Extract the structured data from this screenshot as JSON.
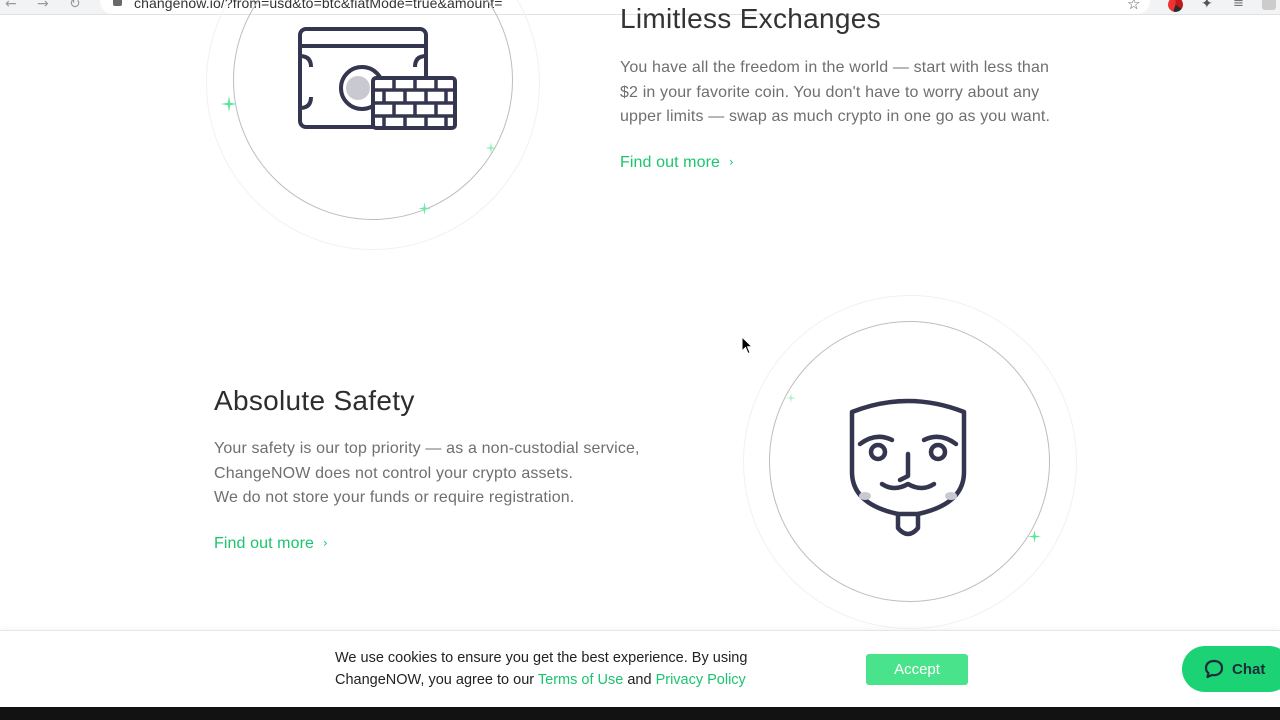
{
  "browser": {
    "url": "changenow.io/?from=usd&to=btc&fiatMode=true&amount=",
    "back_icon": "arrow-left-icon",
    "forward_icon": "arrow-right-icon",
    "reload_icon": "reload-icon",
    "bookmark_icon": "star-icon",
    "extensions_icon": "puzzle-icon",
    "media_icon": "playlist-icon"
  },
  "sections": {
    "limitless": {
      "heading": "Limitless Exchanges",
      "lines": [
        "You have all the freedom in the world — start with less than",
        "$2 in your favorite coin. You don't have to worry about any",
        "upper limits — swap as much crypto in one go as you want."
      ],
      "link": "Find out more",
      "illustration": "banknote-with-bricks-icon"
    },
    "safety": {
      "heading": "Absolute Safety",
      "lines": [
        "Your safety is our top priority — as a non-custodial service,",
        "ChangeNOW does not control your crypto assets.",
        "We do not store your funds or require registration."
      ],
      "link": "Find out more",
      "illustration": "anonymous-mask-icon"
    }
  },
  "cookie": {
    "text_before": "We use cookies to ensure you get the best experience. By using ChangeNOW, you agree to our",
    "terms_link": "Terms of Use",
    "and": "and",
    "privacy_link": "Privacy Policy",
    "accept_label": "Accept"
  },
  "chat": {
    "label": "Chat",
    "icon": "chat-bubble-icon"
  },
  "colors": {
    "accent": "#1bc46e",
    "accept_bg": "#49e38c",
    "chat_bg": "#1bd274",
    "icon_stroke": "#343650"
  }
}
